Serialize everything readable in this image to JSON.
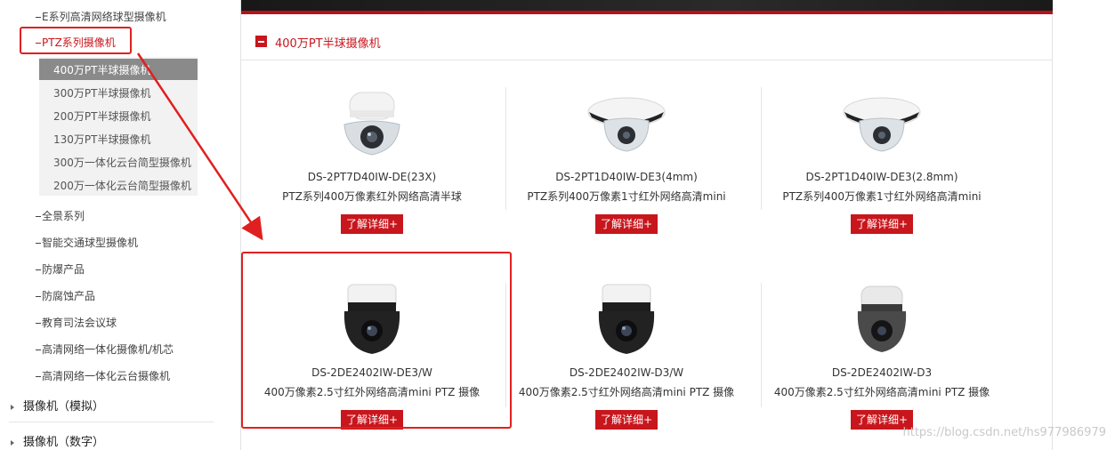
{
  "sidebar": {
    "top_item": "E系列高清网络球型摄像机",
    "active_item": "PTZ系列摄像机",
    "sub_items": [
      "400万PT半球摄像机",
      "300万PT半球摄像机",
      "200万PT半球摄像机",
      "130万PT半球摄像机",
      "300万一体化云台简型摄像机",
      "200万一体化云台简型摄像机"
    ],
    "items": [
      "全景系列",
      "智能交通球型摄像机",
      "防爆产品",
      "防腐蚀产品",
      "教育司法会议球",
      "高清网络一体化摄像机/机芯",
      "高清网络一体化云台摄像机"
    ],
    "categories": [
      "摄像机（模拟）",
      "摄像机（数字）"
    ]
  },
  "section": {
    "title": "400万PT半球摄像机"
  },
  "products": [
    {
      "model": "DS-2PT7D40IW-DE(23X)",
      "desc": "PTZ系列400万像素红外网络高清半球",
      "button": "了解详细+"
    },
    {
      "model": "DS-2PT1D40IW-DE3(4mm)",
      "desc": "PTZ系列400万像素1寸红外网络高清mini",
      "button": "了解详细+"
    },
    {
      "model": "DS-2PT1D40IW-DE3(2.8mm)",
      "desc": "PTZ系列400万像素1寸红外网络高清mini",
      "button": "了解详细+"
    },
    {
      "model": "DS-2DE2402IW-DE3/W",
      "desc": "400万像素2.5寸红外网络高清mini PTZ 摄像",
      "button": "了解详细+"
    },
    {
      "model": "DS-2DE2402IW-D3/W",
      "desc": "400万像素2.5寸红外网络高清mini PTZ 摄像",
      "button": "了解详细+"
    },
    {
      "model": "DS-2DE2402IW-D3",
      "desc": "400万像素2.5寸红外网络高清mini PTZ 摄像",
      "button": "了解详细+"
    }
  ],
  "watermark": "https://blog.csdn.net/hs977986979",
  "colors": {
    "accent": "#c8161d",
    "annotation": "#e02020"
  }
}
